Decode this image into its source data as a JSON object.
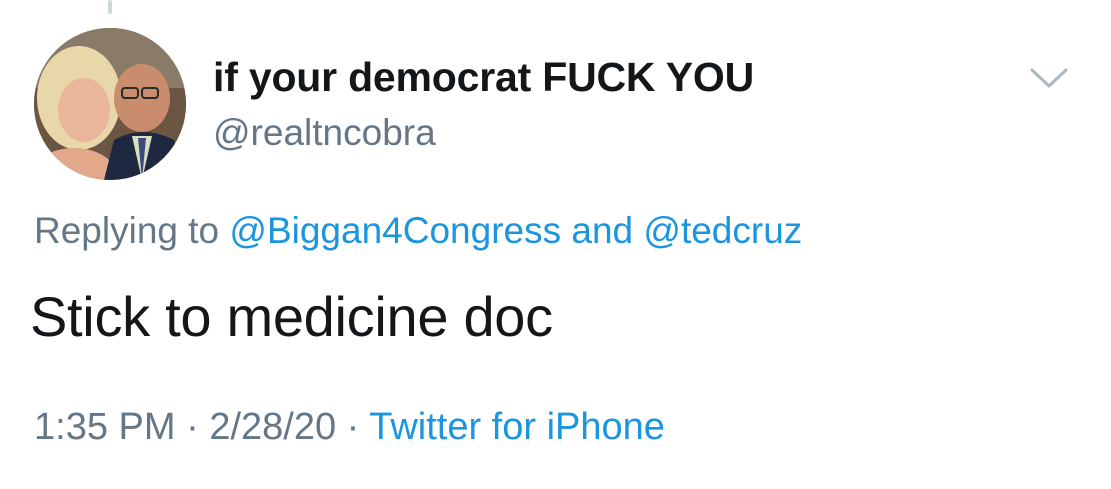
{
  "tweet": {
    "display_name": "if your democrat FUCK YOU",
    "handle": "@realtncobra",
    "replying_prefix": "Replying to",
    "reply_mention_1": "@Biggan4Congress",
    "reply_conjunction": "and",
    "reply_mention_2": "@tedcruz",
    "text": "Stick to medicine doc",
    "time": "1:35 PM",
    "separator": "·",
    "date": "2/28/20",
    "source": "Twitter for iPhone"
  },
  "icons": {
    "menu": "chevron-down-icon",
    "avatar": "profile-photo"
  },
  "colors": {
    "text_primary": "#14171a",
    "text_secondary": "#657786",
    "link": "#1b95e0",
    "thread_line": "#ccd6dd"
  }
}
